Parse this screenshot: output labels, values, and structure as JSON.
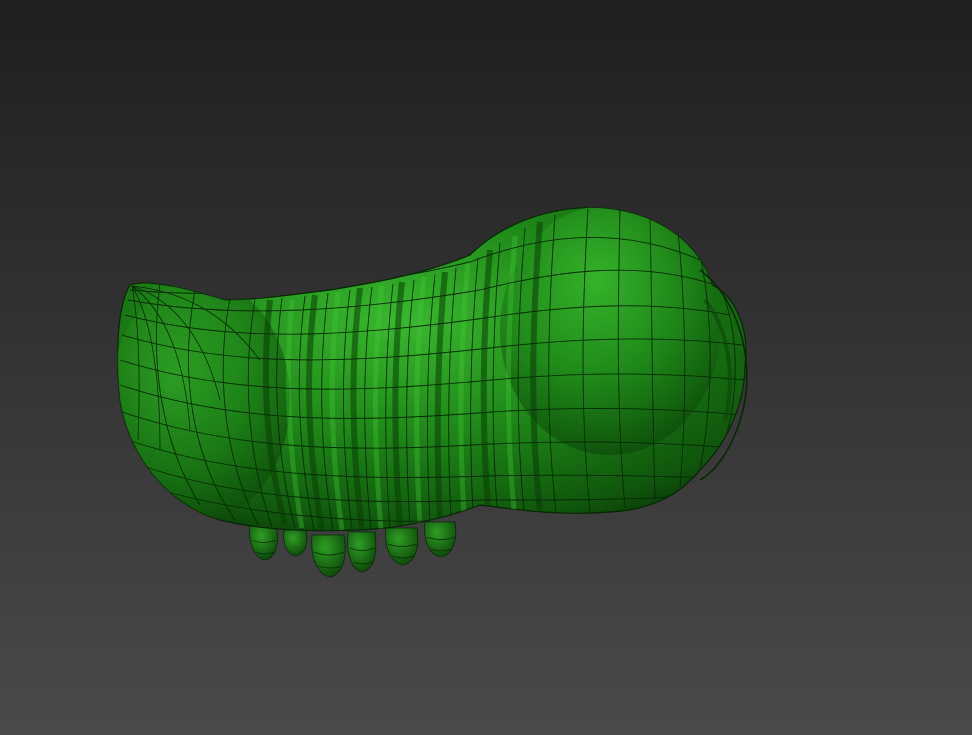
{
  "scene": {
    "subject": "caterpillar-model",
    "display_mode": "shaded-with-wireframe",
    "colors": {
      "background_top": "#1f1f1f",
      "background_bottom": "#4a4a4a",
      "model_base": "#1f8a18",
      "model_highlight": "#3dc232",
      "model_shadow": "#0a3d07",
      "wire": "#062a04"
    }
  }
}
